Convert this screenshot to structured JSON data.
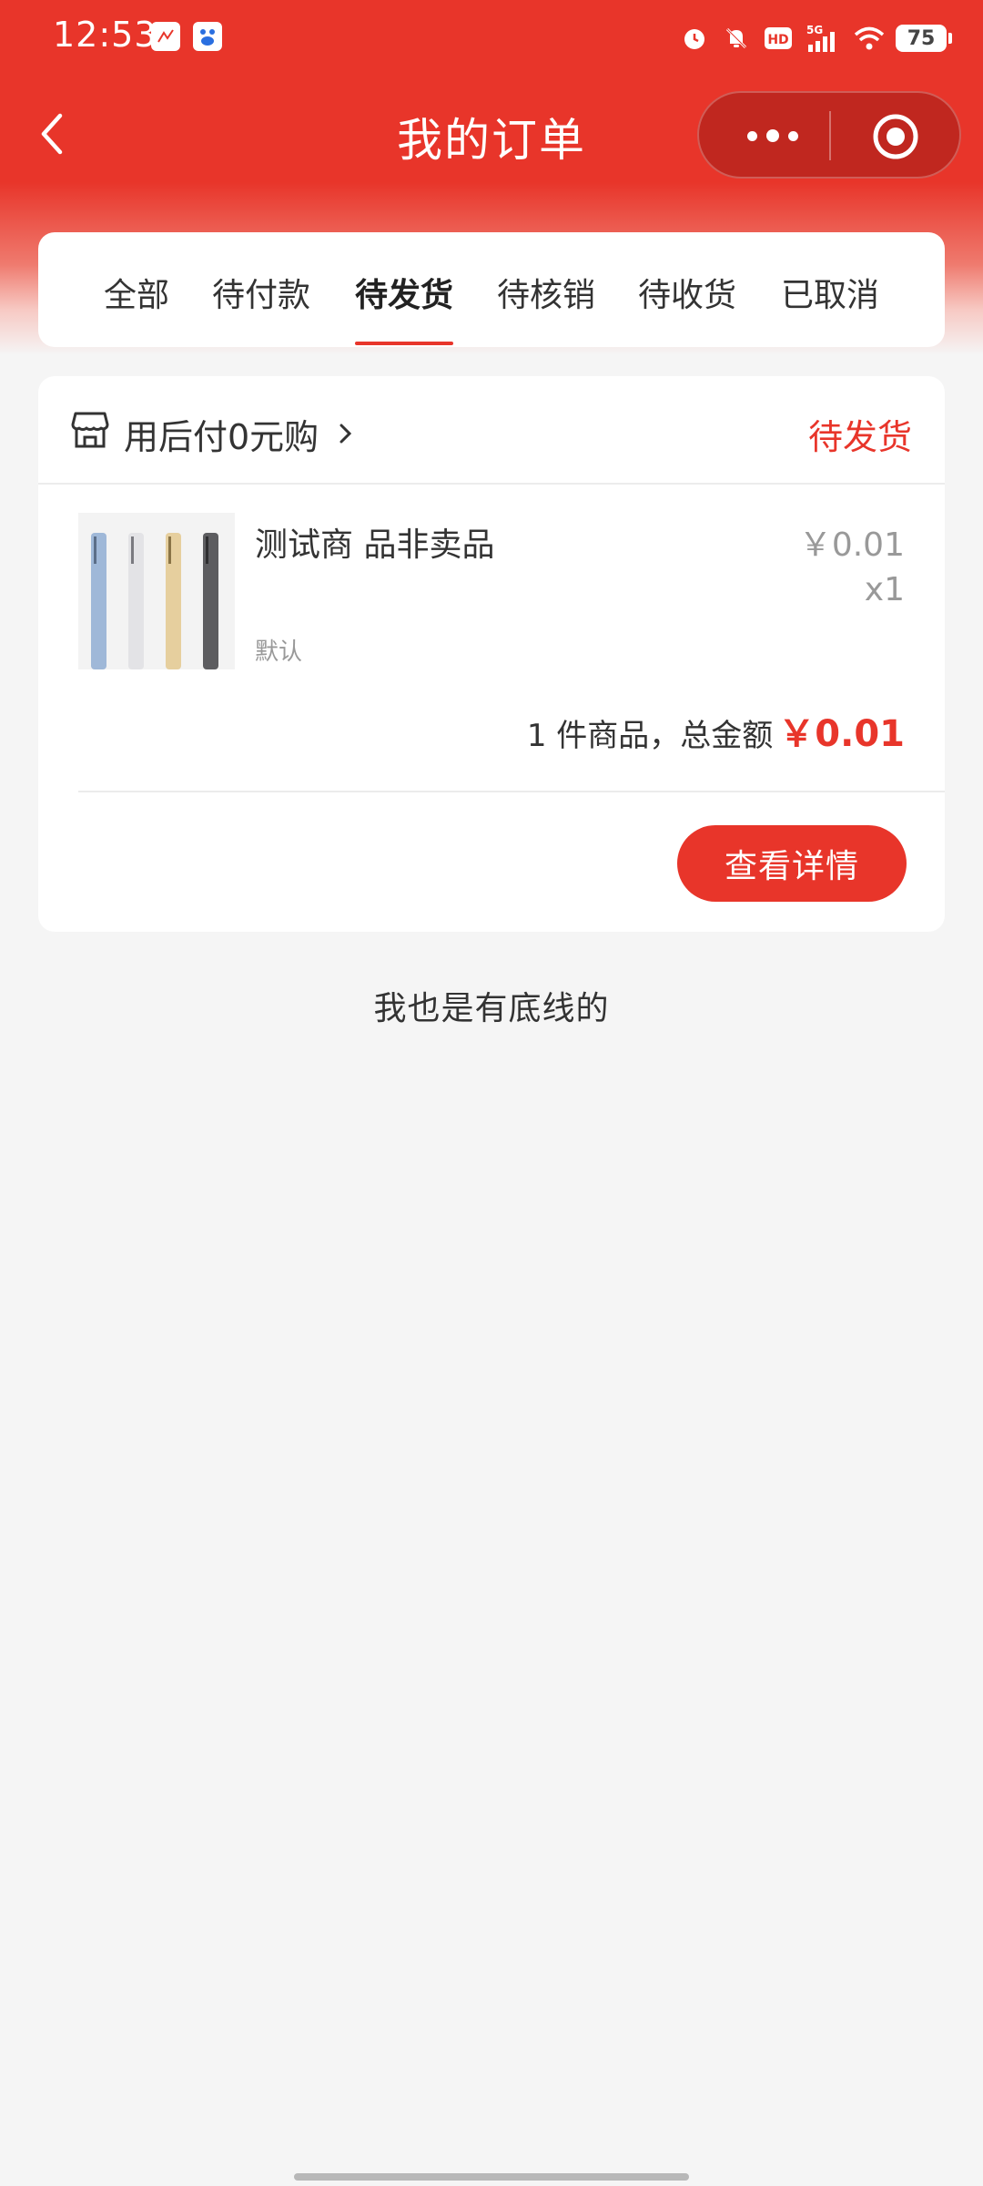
{
  "status_bar": {
    "time": "12:53",
    "network": "5G",
    "hd_label": "HD",
    "battery": "75",
    "icons": [
      "alarm-icon",
      "mute-icon",
      "hd-icon",
      "signal-icon",
      "wifi-icon",
      "battery-icon"
    ]
  },
  "nav": {
    "title": "我的订单",
    "back_icon": "chevron-left-icon",
    "more_icon": "more-dots-icon",
    "close_icon": "target-circle-icon"
  },
  "tabs": [
    {
      "label": "全部",
      "active": false
    },
    {
      "label": "待付款",
      "active": false
    },
    {
      "label": "待发货",
      "active": true
    },
    {
      "label": "待核销",
      "active": false
    },
    {
      "label": "待收货",
      "active": false
    },
    {
      "label": "已取消",
      "active": false
    }
  ],
  "order": {
    "store_name": "用后付0元购",
    "status": "待发货",
    "product": {
      "name": "测试商 品非卖品",
      "spec": "默认",
      "price": "￥0.01",
      "quantity": "x1"
    },
    "total_count": "1 件商品",
    "total_separator": "，",
    "total_label": "总金额",
    "total_amount": "￥0.01",
    "detail_button": "查看详情"
  },
  "footer_text": "我也是有底线的",
  "colors": {
    "primary_red": "#e8352a",
    "background": "#f5f5f5",
    "muted_text": "#999999"
  }
}
